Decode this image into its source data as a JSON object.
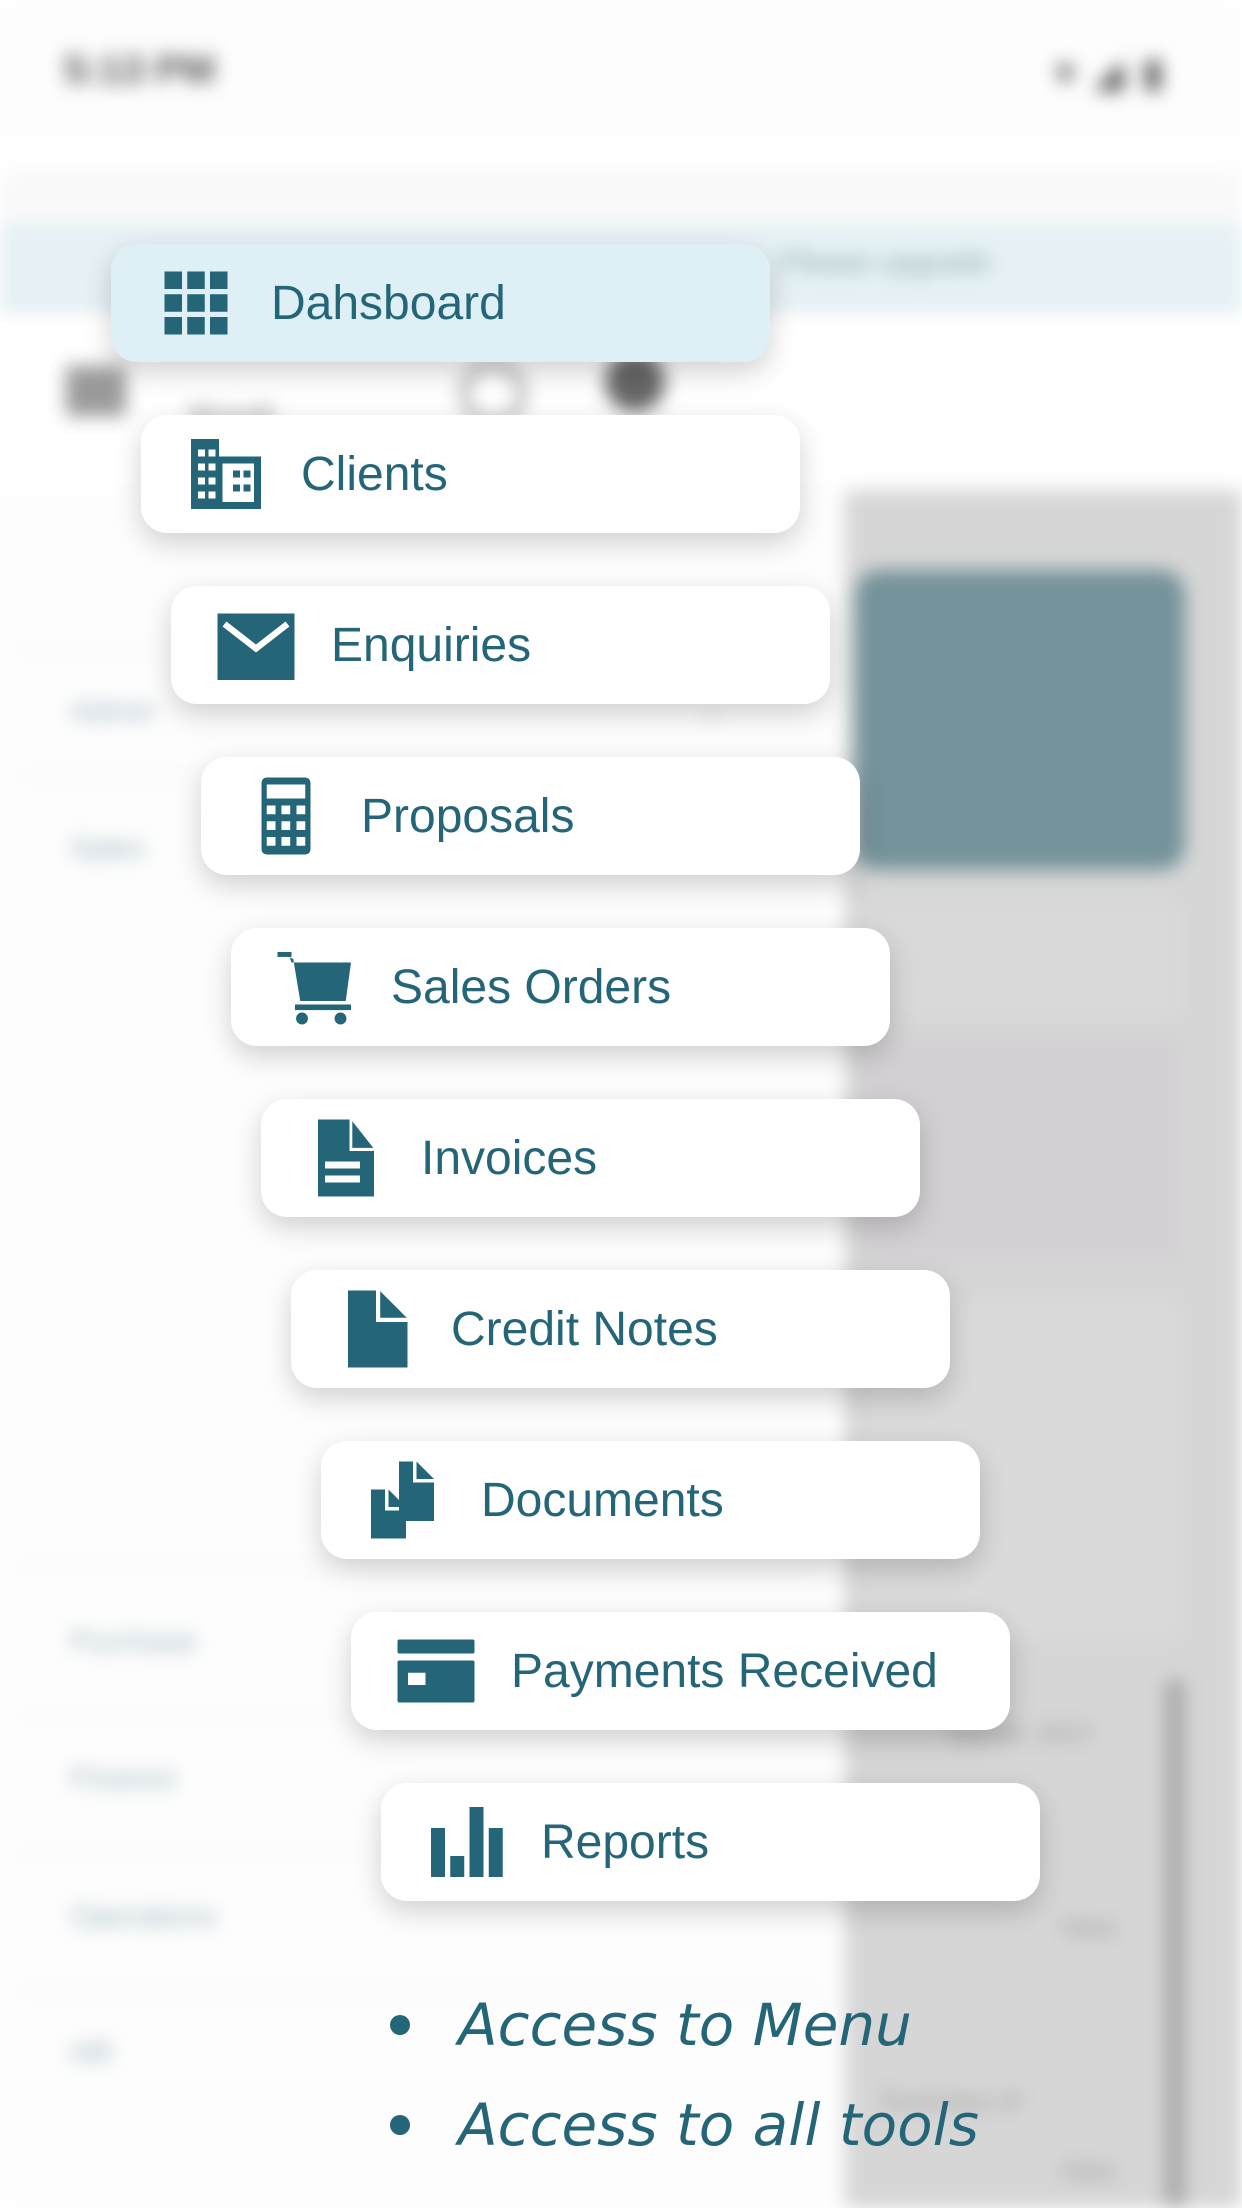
{
  "background": {
    "status_bar": {
      "time": "5:13 PM",
      "icons": [
        "wifi-icon",
        "signal-icon",
        "battery-icon"
      ]
    },
    "banner_text": "Please upgrade",
    "app_name": "Bizsoft",
    "sidebar_items": [
      "Admin",
      "Sales",
      "Purchase",
      "Finance",
      "Operations",
      "HR"
    ],
    "content_texts": [
      "Month: 2017",
      "View",
      "Summary of",
      "View"
    ]
  },
  "menu": {
    "items": [
      {
        "label": "Dahsboard",
        "icon": "grid-icon",
        "active": true
      },
      {
        "label": "Clients",
        "icon": "building-icon",
        "active": false
      },
      {
        "label": "Enquiries",
        "icon": "envelope-icon",
        "active": false
      },
      {
        "label": "Proposals",
        "icon": "calculator-icon",
        "active": false
      },
      {
        "label": "Sales Orders",
        "icon": "cart-icon",
        "active": false
      },
      {
        "label": "Invoices",
        "icon": "document-icon",
        "active": false
      },
      {
        "label": "Credit Notes",
        "icon": "file-icon",
        "active": false
      },
      {
        "label": "Documents",
        "icon": "files-icon",
        "active": false
      },
      {
        "label": "Payments Received",
        "icon": "credit-card-icon",
        "active": false
      },
      {
        "label": "Reports",
        "icon": "bar-chart-icon",
        "active": false
      }
    ]
  },
  "captions": [
    "Access to Menu",
    "Access to all tools"
  ],
  "colors": {
    "accent": "#246577",
    "active_bg": "#def0f5",
    "card_bg": "#ffffff"
  }
}
